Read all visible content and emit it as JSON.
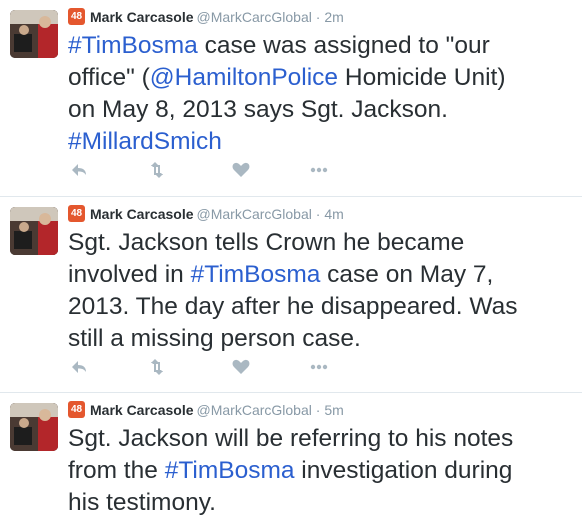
{
  "colors": {
    "accent": "#2b5fcf",
    "badge": "#e4572e",
    "muted": "#8899a6"
  },
  "tweets": [
    {
      "badge": "48",
      "name": "Mark Carcasole",
      "handle": "@MarkCarcGlobal",
      "dot": "·",
      "time": "2m",
      "text": {
        "l1_tag": "#TimBosma",
        "l1_rest": " case was assigned to \"our",
        "l2_pre": "office\" (",
        "l2_tag": "@HamiltonPolice",
        "l2_post": " Homicide Unit)",
        "l3": "on May 8, 2013 says Sgt. Jackson.",
        "l4_tag": "#MillardSmich"
      },
      "actions": [
        "reply-icon",
        "retweet-icon",
        "like-icon",
        "more-icon"
      ]
    },
    {
      "badge": "48",
      "name": "Mark Carcasole",
      "handle": "@MarkCarcGlobal",
      "dot": "·",
      "time": "4m",
      "text": {
        "l1": "Sgt. Jackson tells Crown he became",
        "l2_pre": "involved in ",
        "l2_tag": "#TimBosma",
        "l2_post": " case on May 7,",
        "l3": "2013. The day after he disappeared. Was",
        "l4": "still a missing person case."
      },
      "actions": [
        "reply-icon",
        "retweet-icon",
        "like-icon",
        "more-icon"
      ]
    },
    {
      "badge": "48",
      "name": "Mark Carcasole",
      "handle": "@MarkCarcGlobal",
      "dot": "·",
      "time": "5m",
      "text": {
        "l1": "Sgt. Jackson will be referring to his notes",
        "l2_pre": "from the ",
        "l2_tag": "#TimBosma",
        "l2_post": " investigation during",
        "l3": "his testimony."
      }
    }
  ]
}
